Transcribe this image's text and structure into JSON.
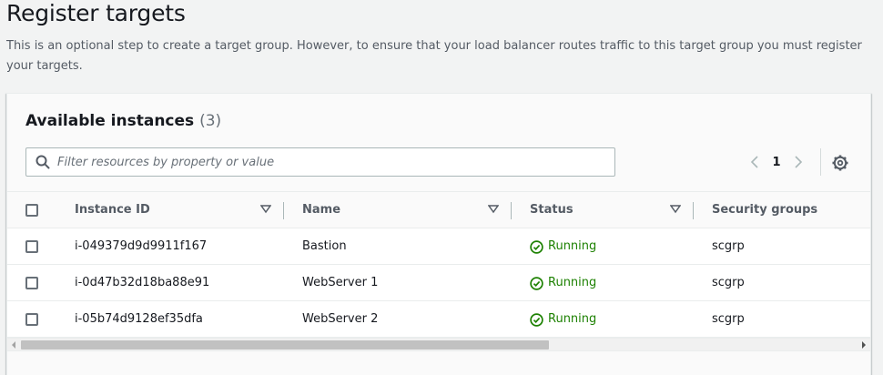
{
  "page": {
    "title": "Register targets",
    "description": "This is an optional step to create a target group. However, to ensure that your load balancer routes traffic to this target group you must register your targets."
  },
  "panel": {
    "title": "Available instances",
    "count": "(3)",
    "filter_placeholder": "Filter resources by property or value",
    "pagination": {
      "current_page": "1"
    },
    "icons": {
      "search": "search-icon",
      "prev": "chevron-left-icon",
      "next": "chevron-right-icon",
      "settings": "gear-icon",
      "sort": "caret-down-icon",
      "status": "check-circle-icon"
    }
  },
  "table": {
    "columns": [
      "Instance ID",
      "Name",
      "Status",
      "Security groups"
    ],
    "rows": [
      {
        "instance_id": "i-049379d9d9911f167",
        "name": "Bastion",
        "status": "Running",
        "security_groups": "scgrp"
      },
      {
        "instance_id": "i-0d47b32d18ba88e91",
        "name": "WebServer 1",
        "status": "Running",
        "security_groups": "scgrp"
      },
      {
        "instance_id": "i-05b74d9128ef35dfa",
        "name": "WebServer 2",
        "status": "Running",
        "security_groups": "scgrp"
      }
    ]
  },
  "colors": {
    "running": "#1d8102",
    "text": "#16191f",
    "muted": "#545b64"
  }
}
